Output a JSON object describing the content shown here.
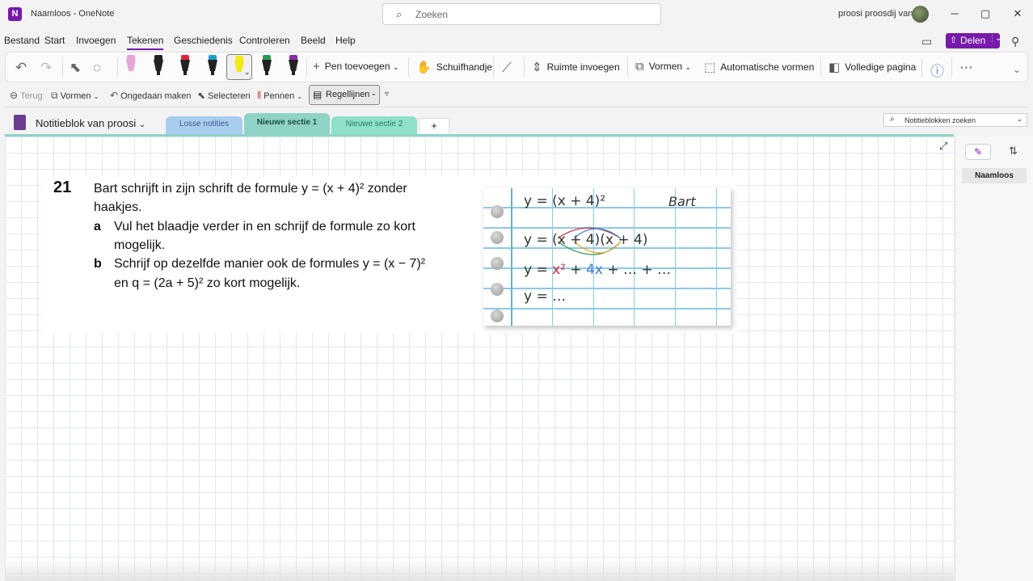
{
  "titlebar": {
    "app_logo": "N",
    "title": "Naamloos - OneNote",
    "search_placeholder": "Zoeken",
    "user_name": "proosi proosdij van",
    "minimize": "─",
    "restore": "▢",
    "close": "✕"
  },
  "menu": {
    "items": [
      "Bestand",
      "Start",
      "Invoegen",
      "Tekenen",
      "Geschiedenis",
      "Controleren",
      "Beeld",
      "Help"
    ],
    "active": "Tekenen",
    "share_label": "Delen"
  },
  "ribbon": {
    "pen_colors": [
      "#e8a6d6",
      "#222222",
      "#d9263d",
      "#1fa0c9",
      "#f4e81c",
      "#2a9c52",
      "#8a2ea5"
    ],
    "add_pen": "Pen toevoegen",
    "hand": "Schuifhandje",
    "insert_space": "Ruimte invoegen",
    "shapes": "Vormen",
    "auto_shapes": "Automatische vormen",
    "full_page": "Volledige pagina"
  },
  "subbar": {
    "back": "Terug",
    "shapes": "Vormen",
    "undo": "Ongedaan maken",
    "select": "Selecteren",
    "pens": "Pennen",
    "rule_lines": "Regellijnen"
  },
  "notebook": {
    "name": "Notitieblok van proosi",
    "tabs": [
      {
        "label": "Losse notities",
        "color": "#a9cdef"
      },
      {
        "label": "Nieuwe sectie 1",
        "color": "#8fd3c6"
      },
      {
        "label": "Nieuwe sectie 2",
        "color": "#8fe0c8"
      }
    ],
    "add_tab": "+",
    "search_placeholder": "Notitieblokken zoeken"
  },
  "exercise": {
    "number": "21",
    "line1": "Bart schrijft in zijn schrift de formule y = (x + 4)² zonder",
    "line2": "haakjes.",
    "a_label": "a",
    "a_line1": "Vul het blaadje verder in en schrijf de formule zo kort",
    "a_line2": "mogelijk.",
    "b_label": "b",
    "b_line1": "Schrijf op dezelfde manier ook de formules y = (x − 7)²",
    "b_line2": "en q = (2a + 5)² zo kort mogelijk."
  },
  "handwriting": {
    "line1": "y = (x + 4)²",
    "name": "Bart",
    "line2": "y = (x + 4)(x + 4)",
    "line3_start": "y = ",
    "line3_x2": "x²",
    "line3_mid": " + ",
    "line3_4x": "4x",
    "line3_end": " + … + …",
    "line4": "y = …"
  },
  "sidepanel": {
    "page_title": "Naamloos"
  }
}
